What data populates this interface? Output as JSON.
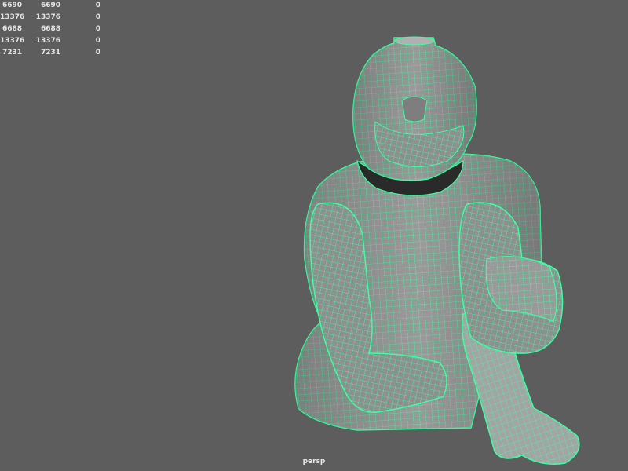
{
  "viewport": {
    "camera_label": "persp",
    "background_color": "#5d5d5d",
    "wireframe_color": "#3cffa0",
    "mesh_color": "#9e9e9e"
  },
  "hud": {
    "rows": [
      [
        "6690",
        "6690",
        "0"
      ],
      [
        "13376",
        "13376",
        "0"
      ],
      [
        "6688",
        "6688",
        "0"
      ],
      [
        "13376",
        "13376",
        "0"
      ],
      [
        "7231",
        "7231",
        "0"
      ]
    ]
  }
}
